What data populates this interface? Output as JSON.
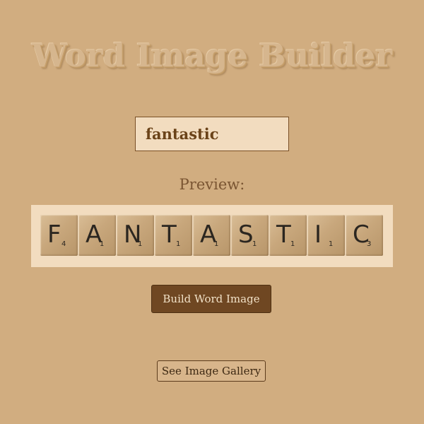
{
  "header": {
    "title": "Word Image Builder"
  },
  "input": {
    "value": "fantastic"
  },
  "preview": {
    "label": "Preview:",
    "tiles": [
      {
        "letter": "F",
        "points": "4"
      },
      {
        "letter": "A",
        "points": "1"
      },
      {
        "letter": "N",
        "points": "1"
      },
      {
        "letter": "T",
        "points": "1"
      },
      {
        "letter": "A",
        "points": "1"
      },
      {
        "letter": "S",
        "points": "1"
      },
      {
        "letter": "T",
        "points": "1"
      },
      {
        "letter": "I",
        "points": "1"
      },
      {
        "letter": "C",
        "points": "3"
      }
    ]
  },
  "actions": {
    "build_label": "Build Word Image",
    "gallery_label": "See Image Gallery"
  },
  "colors": {
    "background": "#d1ad80",
    "input_background": "#f2dcbf",
    "primary_button": "#6f4722"
  }
}
